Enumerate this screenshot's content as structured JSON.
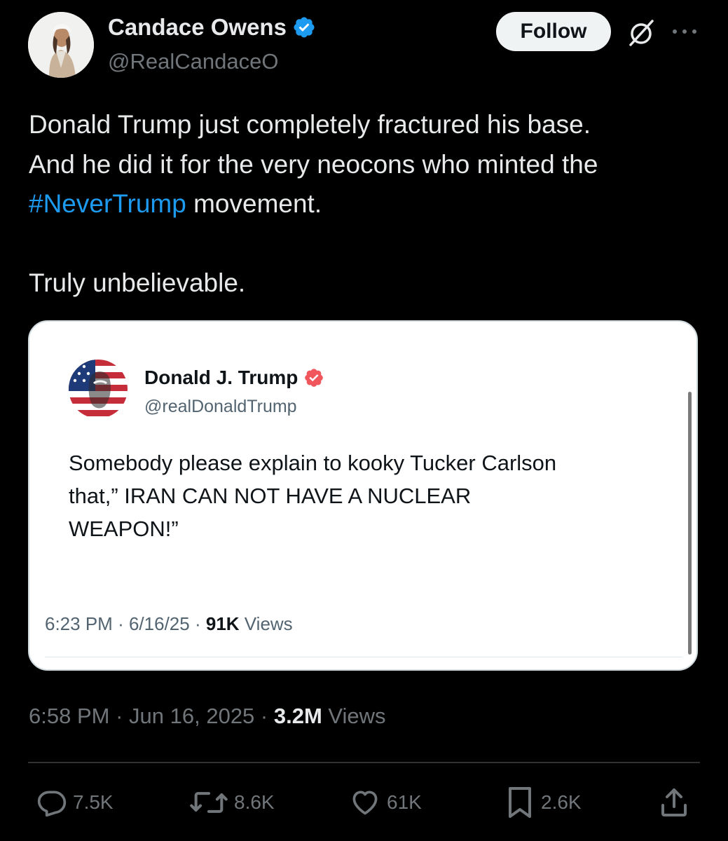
{
  "author": {
    "display_name": "Candace Owens",
    "handle": "@RealCandaceO",
    "verified_icon": "verified-badge-icon"
  },
  "header": {
    "follow_label": "Follow",
    "grok_icon": "grok-icon",
    "more_icon": "more-options-icon"
  },
  "tweet": {
    "line1": "Donald Trump just completely fractured his base.",
    "line2": "And he did it for the very neocons who minted the",
    "hashtag": "#NeverTrump",
    "line3_rest": " movement.",
    "line4": "Truly unbelievable."
  },
  "quote": {
    "display_name": "Donald J. Trump",
    "handle": "@realDonaldTrump",
    "text_line1": "Somebody please explain to kooky Tucker Carlson",
    "text_line2": "that,” IRAN CAN NOT HAVE A NUCLEAR",
    "text_line3": "WEAPON!”",
    "time": "6:23 PM",
    "date": "6/16/25",
    "views_count": "91K",
    "views_label": "Views",
    "separator": "·"
  },
  "post_meta": {
    "time": "6:58 PM",
    "date": "Jun 16, 2025",
    "views_count": "3.2M",
    "views_label": "Views",
    "separator": "·"
  },
  "actions": {
    "replies": "7.5K",
    "reposts": "8.6K",
    "likes": "61K",
    "bookmarks": "2.6K"
  },
  "colors": {
    "background": "#000000",
    "text_primary": "#e7e9ea",
    "text_secondary": "#71767b",
    "link": "#1d9bf0",
    "verified_blue": "#1d9bf0",
    "verified_red": "#f0565b",
    "divider": "#2f3336"
  }
}
